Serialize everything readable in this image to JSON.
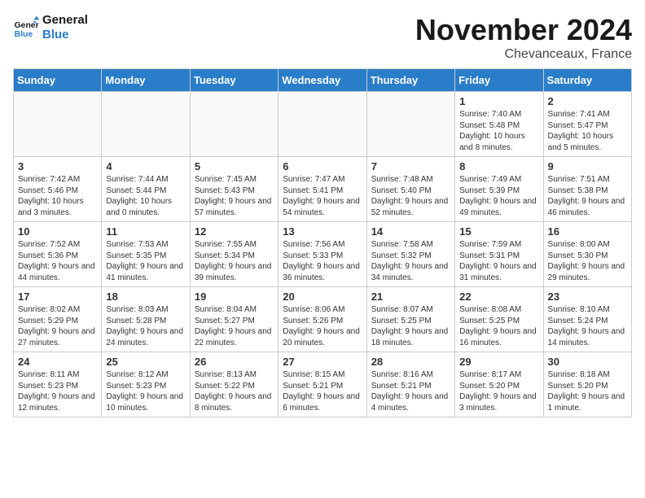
{
  "logo": {
    "line1": "General",
    "line2": "Blue"
  },
  "title": "November 2024",
  "subtitle": "Chevanceaux, France",
  "weekdays": [
    "Sunday",
    "Monday",
    "Tuesday",
    "Wednesday",
    "Thursday",
    "Friday",
    "Saturday"
  ],
  "weeks": [
    [
      {
        "day": "",
        "info": ""
      },
      {
        "day": "",
        "info": ""
      },
      {
        "day": "",
        "info": ""
      },
      {
        "day": "",
        "info": ""
      },
      {
        "day": "",
        "info": ""
      },
      {
        "day": "1",
        "info": "Sunrise: 7:40 AM\nSunset: 5:48 PM\nDaylight: 10 hours and 8 minutes."
      },
      {
        "day": "2",
        "info": "Sunrise: 7:41 AM\nSunset: 5:47 PM\nDaylight: 10 hours and 5 minutes."
      }
    ],
    [
      {
        "day": "3",
        "info": "Sunrise: 7:42 AM\nSunset: 5:46 PM\nDaylight: 10 hours and 3 minutes."
      },
      {
        "day": "4",
        "info": "Sunrise: 7:44 AM\nSunset: 5:44 PM\nDaylight: 10 hours and 0 minutes."
      },
      {
        "day": "5",
        "info": "Sunrise: 7:45 AM\nSunset: 5:43 PM\nDaylight: 9 hours and 57 minutes."
      },
      {
        "day": "6",
        "info": "Sunrise: 7:47 AM\nSunset: 5:41 PM\nDaylight: 9 hours and 54 minutes."
      },
      {
        "day": "7",
        "info": "Sunrise: 7:48 AM\nSunset: 5:40 PM\nDaylight: 9 hours and 52 minutes."
      },
      {
        "day": "8",
        "info": "Sunrise: 7:49 AM\nSunset: 5:39 PM\nDaylight: 9 hours and 49 minutes."
      },
      {
        "day": "9",
        "info": "Sunrise: 7:51 AM\nSunset: 5:38 PM\nDaylight: 9 hours and 46 minutes."
      }
    ],
    [
      {
        "day": "10",
        "info": "Sunrise: 7:52 AM\nSunset: 5:36 PM\nDaylight: 9 hours and 44 minutes."
      },
      {
        "day": "11",
        "info": "Sunrise: 7:53 AM\nSunset: 5:35 PM\nDaylight: 9 hours and 41 minutes."
      },
      {
        "day": "12",
        "info": "Sunrise: 7:55 AM\nSunset: 5:34 PM\nDaylight: 9 hours and 39 minutes."
      },
      {
        "day": "13",
        "info": "Sunrise: 7:56 AM\nSunset: 5:33 PM\nDaylight: 9 hours and 36 minutes."
      },
      {
        "day": "14",
        "info": "Sunrise: 7:58 AM\nSunset: 5:32 PM\nDaylight: 9 hours and 34 minutes."
      },
      {
        "day": "15",
        "info": "Sunrise: 7:59 AM\nSunset: 5:31 PM\nDaylight: 9 hours and 31 minutes."
      },
      {
        "day": "16",
        "info": "Sunrise: 8:00 AM\nSunset: 5:30 PM\nDaylight: 9 hours and 29 minutes."
      }
    ],
    [
      {
        "day": "17",
        "info": "Sunrise: 8:02 AM\nSunset: 5:29 PM\nDaylight: 9 hours and 27 minutes."
      },
      {
        "day": "18",
        "info": "Sunrise: 8:03 AM\nSunset: 5:28 PM\nDaylight: 9 hours and 24 minutes."
      },
      {
        "day": "19",
        "info": "Sunrise: 8:04 AM\nSunset: 5:27 PM\nDaylight: 9 hours and 22 minutes."
      },
      {
        "day": "20",
        "info": "Sunrise: 8:06 AM\nSunset: 5:26 PM\nDaylight: 9 hours and 20 minutes."
      },
      {
        "day": "21",
        "info": "Sunrise: 8:07 AM\nSunset: 5:25 PM\nDaylight: 9 hours and 18 minutes."
      },
      {
        "day": "22",
        "info": "Sunrise: 8:08 AM\nSunset: 5:25 PM\nDaylight: 9 hours and 16 minutes."
      },
      {
        "day": "23",
        "info": "Sunrise: 8:10 AM\nSunset: 5:24 PM\nDaylight: 9 hours and 14 minutes."
      }
    ],
    [
      {
        "day": "24",
        "info": "Sunrise: 8:11 AM\nSunset: 5:23 PM\nDaylight: 9 hours and 12 minutes."
      },
      {
        "day": "25",
        "info": "Sunrise: 8:12 AM\nSunset: 5:23 PM\nDaylight: 9 hours and 10 minutes."
      },
      {
        "day": "26",
        "info": "Sunrise: 8:13 AM\nSunset: 5:22 PM\nDaylight: 9 hours and 8 minutes."
      },
      {
        "day": "27",
        "info": "Sunrise: 8:15 AM\nSunset: 5:21 PM\nDaylight: 9 hours and 6 minutes."
      },
      {
        "day": "28",
        "info": "Sunrise: 8:16 AM\nSunset: 5:21 PM\nDaylight: 9 hours and 4 minutes."
      },
      {
        "day": "29",
        "info": "Sunrise: 8:17 AM\nSunset: 5:20 PM\nDaylight: 9 hours and 3 minutes."
      },
      {
        "day": "30",
        "info": "Sunrise: 8:18 AM\nSunset: 5:20 PM\nDaylight: 9 hours and 1 minute."
      }
    ]
  ]
}
